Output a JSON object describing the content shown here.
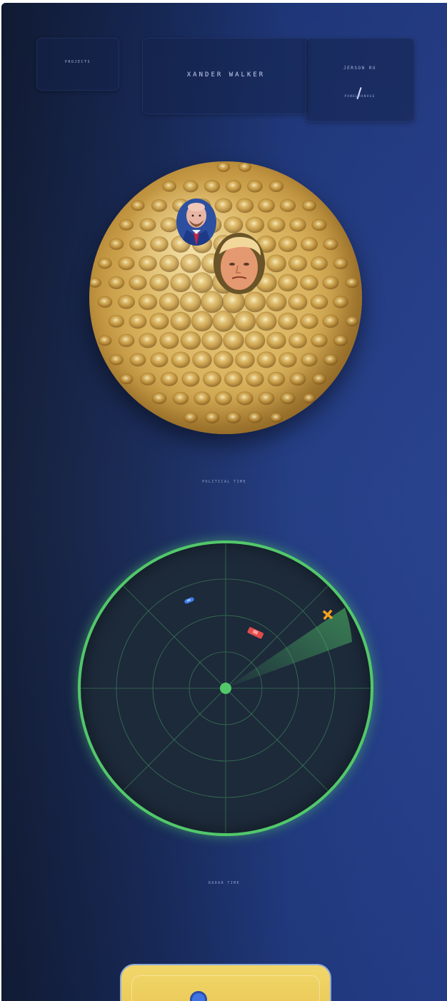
{
  "tiles": {
    "projects": "PROJECTS",
    "name": "XANDER WALKER",
    "version_top": "JERSON RU",
    "version_bottom": "PANELMANAGE"
  },
  "sections": {
    "political_caption": "POLITICAL TIME",
    "radar_caption": "RADAR TIME"
  },
  "golf_ball": {
    "icon": "golf-ball-icon",
    "color": "#d9b25d"
  },
  "radar": {
    "ring_color": "#52c86a",
    "blips": [
      {
        "icon": "blue-boat-icon",
        "color": "#3f7df0"
      },
      {
        "icon": "red-boat-icon",
        "color": "#e24b4b"
      },
      {
        "icon": "airplane-icon",
        "color": "#f4a020"
      }
    ]
  },
  "bottom_card": {
    "color": "#f0d060",
    "knob_color": "#3f74e2"
  }
}
